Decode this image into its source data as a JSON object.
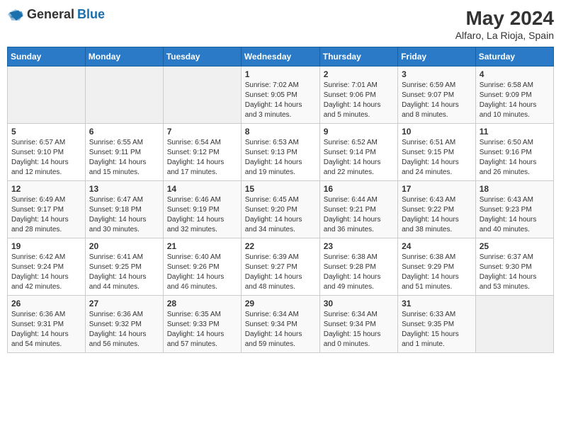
{
  "header": {
    "logo_general": "General",
    "logo_blue": "Blue",
    "month_year": "May 2024",
    "location": "Alfaro, La Rioja, Spain"
  },
  "weekdays": [
    "Sunday",
    "Monday",
    "Tuesday",
    "Wednesday",
    "Thursday",
    "Friday",
    "Saturday"
  ],
  "weeks": [
    [
      {
        "day": "",
        "info": ""
      },
      {
        "day": "",
        "info": ""
      },
      {
        "day": "",
        "info": ""
      },
      {
        "day": "1",
        "info": "Sunrise: 7:02 AM\nSunset: 9:05 PM\nDaylight: 14 hours\nand 3 minutes."
      },
      {
        "day": "2",
        "info": "Sunrise: 7:01 AM\nSunset: 9:06 PM\nDaylight: 14 hours\nand 5 minutes."
      },
      {
        "day": "3",
        "info": "Sunrise: 6:59 AM\nSunset: 9:07 PM\nDaylight: 14 hours\nand 8 minutes."
      },
      {
        "day": "4",
        "info": "Sunrise: 6:58 AM\nSunset: 9:09 PM\nDaylight: 14 hours\nand 10 minutes."
      }
    ],
    [
      {
        "day": "5",
        "info": "Sunrise: 6:57 AM\nSunset: 9:10 PM\nDaylight: 14 hours\nand 12 minutes."
      },
      {
        "day": "6",
        "info": "Sunrise: 6:55 AM\nSunset: 9:11 PM\nDaylight: 14 hours\nand 15 minutes."
      },
      {
        "day": "7",
        "info": "Sunrise: 6:54 AM\nSunset: 9:12 PM\nDaylight: 14 hours\nand 17 minutes."
      },
      {
        "day": "8",
        "info": "Sunrise: 6:53 AM\nSunset: 9:13 PM\nDaylight: 14 hours\nand 19 minutes."
      },
      {
        "day": "9",
        "info": "Sunrise: 6:52 AM\nSunset: 9:14 PM\nDaylight: 14 hours\nand 22 minutes."
      },
      {
        "day": "10",
        "info": "Sunrise: 6:51 AM\nSunset: 9:15 PM\nDaylight: 14 hours\nand 24 minutes."
      },
      {
        "day": "11",
        "info": "Sunrise: 6:50 AM\nSunset: 9:16 PM\nDaylight: 14 hours\nand 26 minutes."
      }
    ],
    [
      {
        "day": "12",
        "info": "Sunrise: 6:49 AM\nSunset: 9:17 PM\nDaylight: 14 hours\nand 28 minutes."
      },
      {
        "day": "13",
        "info": "Sunrise: 6:47 AM\nSunset: 9:18 PM\nDaylight: 14 hours\nand 30 minutes."
      },
      {
        "day": "14",
        "info": "Sunrise: 6:46 AM\nSunset: 9:19 PM\nDaylight: 14 hours\nand 32 minutes."
      },
      {
        "day": "15",
        "info": "Sunrise: 6:45 AM\nSunset: 9:20 PM\nDaylight: 14 hours\nand 34 minutes."
      },
      {
        "day": "16",
        "info": "Sunrise: 6:44 AM\nSunset: 9:21 PM\nDaylight: 14 hours\nand 36 minutes."
      },
      {
        "day": "17",
        "info": "Sunrise: 6:43 AM\nSunset: 9:22 PM\nDaylight: 14 hours\nand 38 minutes."
      },
      {
        "day": "18",
        "info": "Sunrise: 6:43 AM\nSunset: 9:23 PM\nDaylight: 14 hours\nand 40 minutes."
      }
    ],
    [
      {
        "day": "19",
        "info": "Sunrise: 6:42 AM\nSunset: 9:24 PM\nDaylight: 14 hours\nand 42 minutes."
      },
      {
        "day": "20",
        "info": "Sunrise: 6:41 AM\nSunset: 9:25 PM\nDaylight: 14 hours\nand 44 minutes."
      },
      {
        "day": "21",
        "info": "Sunrise: 6:40 AM\nSunset: 9:26 PM\nDaylight: 14 hours\nand 46 minutes."
      },
      {
        "day": "22",
        "info": "Sunrise: 6:39 AM\nSunset: 9:27 PM\nDaylight: 14 hours\nand 48 minutes."
      },
      {
        "day": "23",
        "info": "Sunrise: 6:38 AM\nSunset: 9:28 PM\nDaylight: 14 hours\nand 49 minutes."
      },
      {
        "day": "24",
        "info": "Sunrise: 6:38 AM\nSunset: 9:29 PM\nDaylight: 14 hours\nand 51 minutes."
      },
      {
        "day": "25",
        "info": "Sunrise: 6:37 AM\nSunset: 9:30 PM\nDaylight: 14 hours\nand 53 minutes."
      }
    ],
    [
      {
        "day": "26",
        "info": "Sunrise: 6:36 AM\nSunset: 9:31 PM\nDaylight: 14 hours\nand 54 minutes."
      },
      {
        "day": "27",
        "info": "Sunrise: 6:36 AM\nSunset: 9:32 PM\nDaylight: 14 hours\nand 56 minutes."
      },
      {
        "day": "28",
        "info": "Sunrise: 6:35 AM\nSunset: 9:33 PM\nDaylight: 14 hours\nand 57 minutes."
      },
      {
        "day": "29",
        "info": "Sunrise: 6:34 AM\nSunset: 9:34 PM\nDaylight: 14 hours\nand 59 minutes."
      },
      {
        "day": "30",
        "info": "Sunrise: 6:34 AM\nSunset: 9:34 PM\nDaylight: 15 hours\nand 0 minutes."
      },
      {
        "day": "31",
        "info": "Sunrise: 6:33 AM\nSunset: 9:35 PM\nDaylight: 15 hours\nand 1 minute."
      },
      {
        "day": "",
        "info": ""
      }
    ]
  ]
}
